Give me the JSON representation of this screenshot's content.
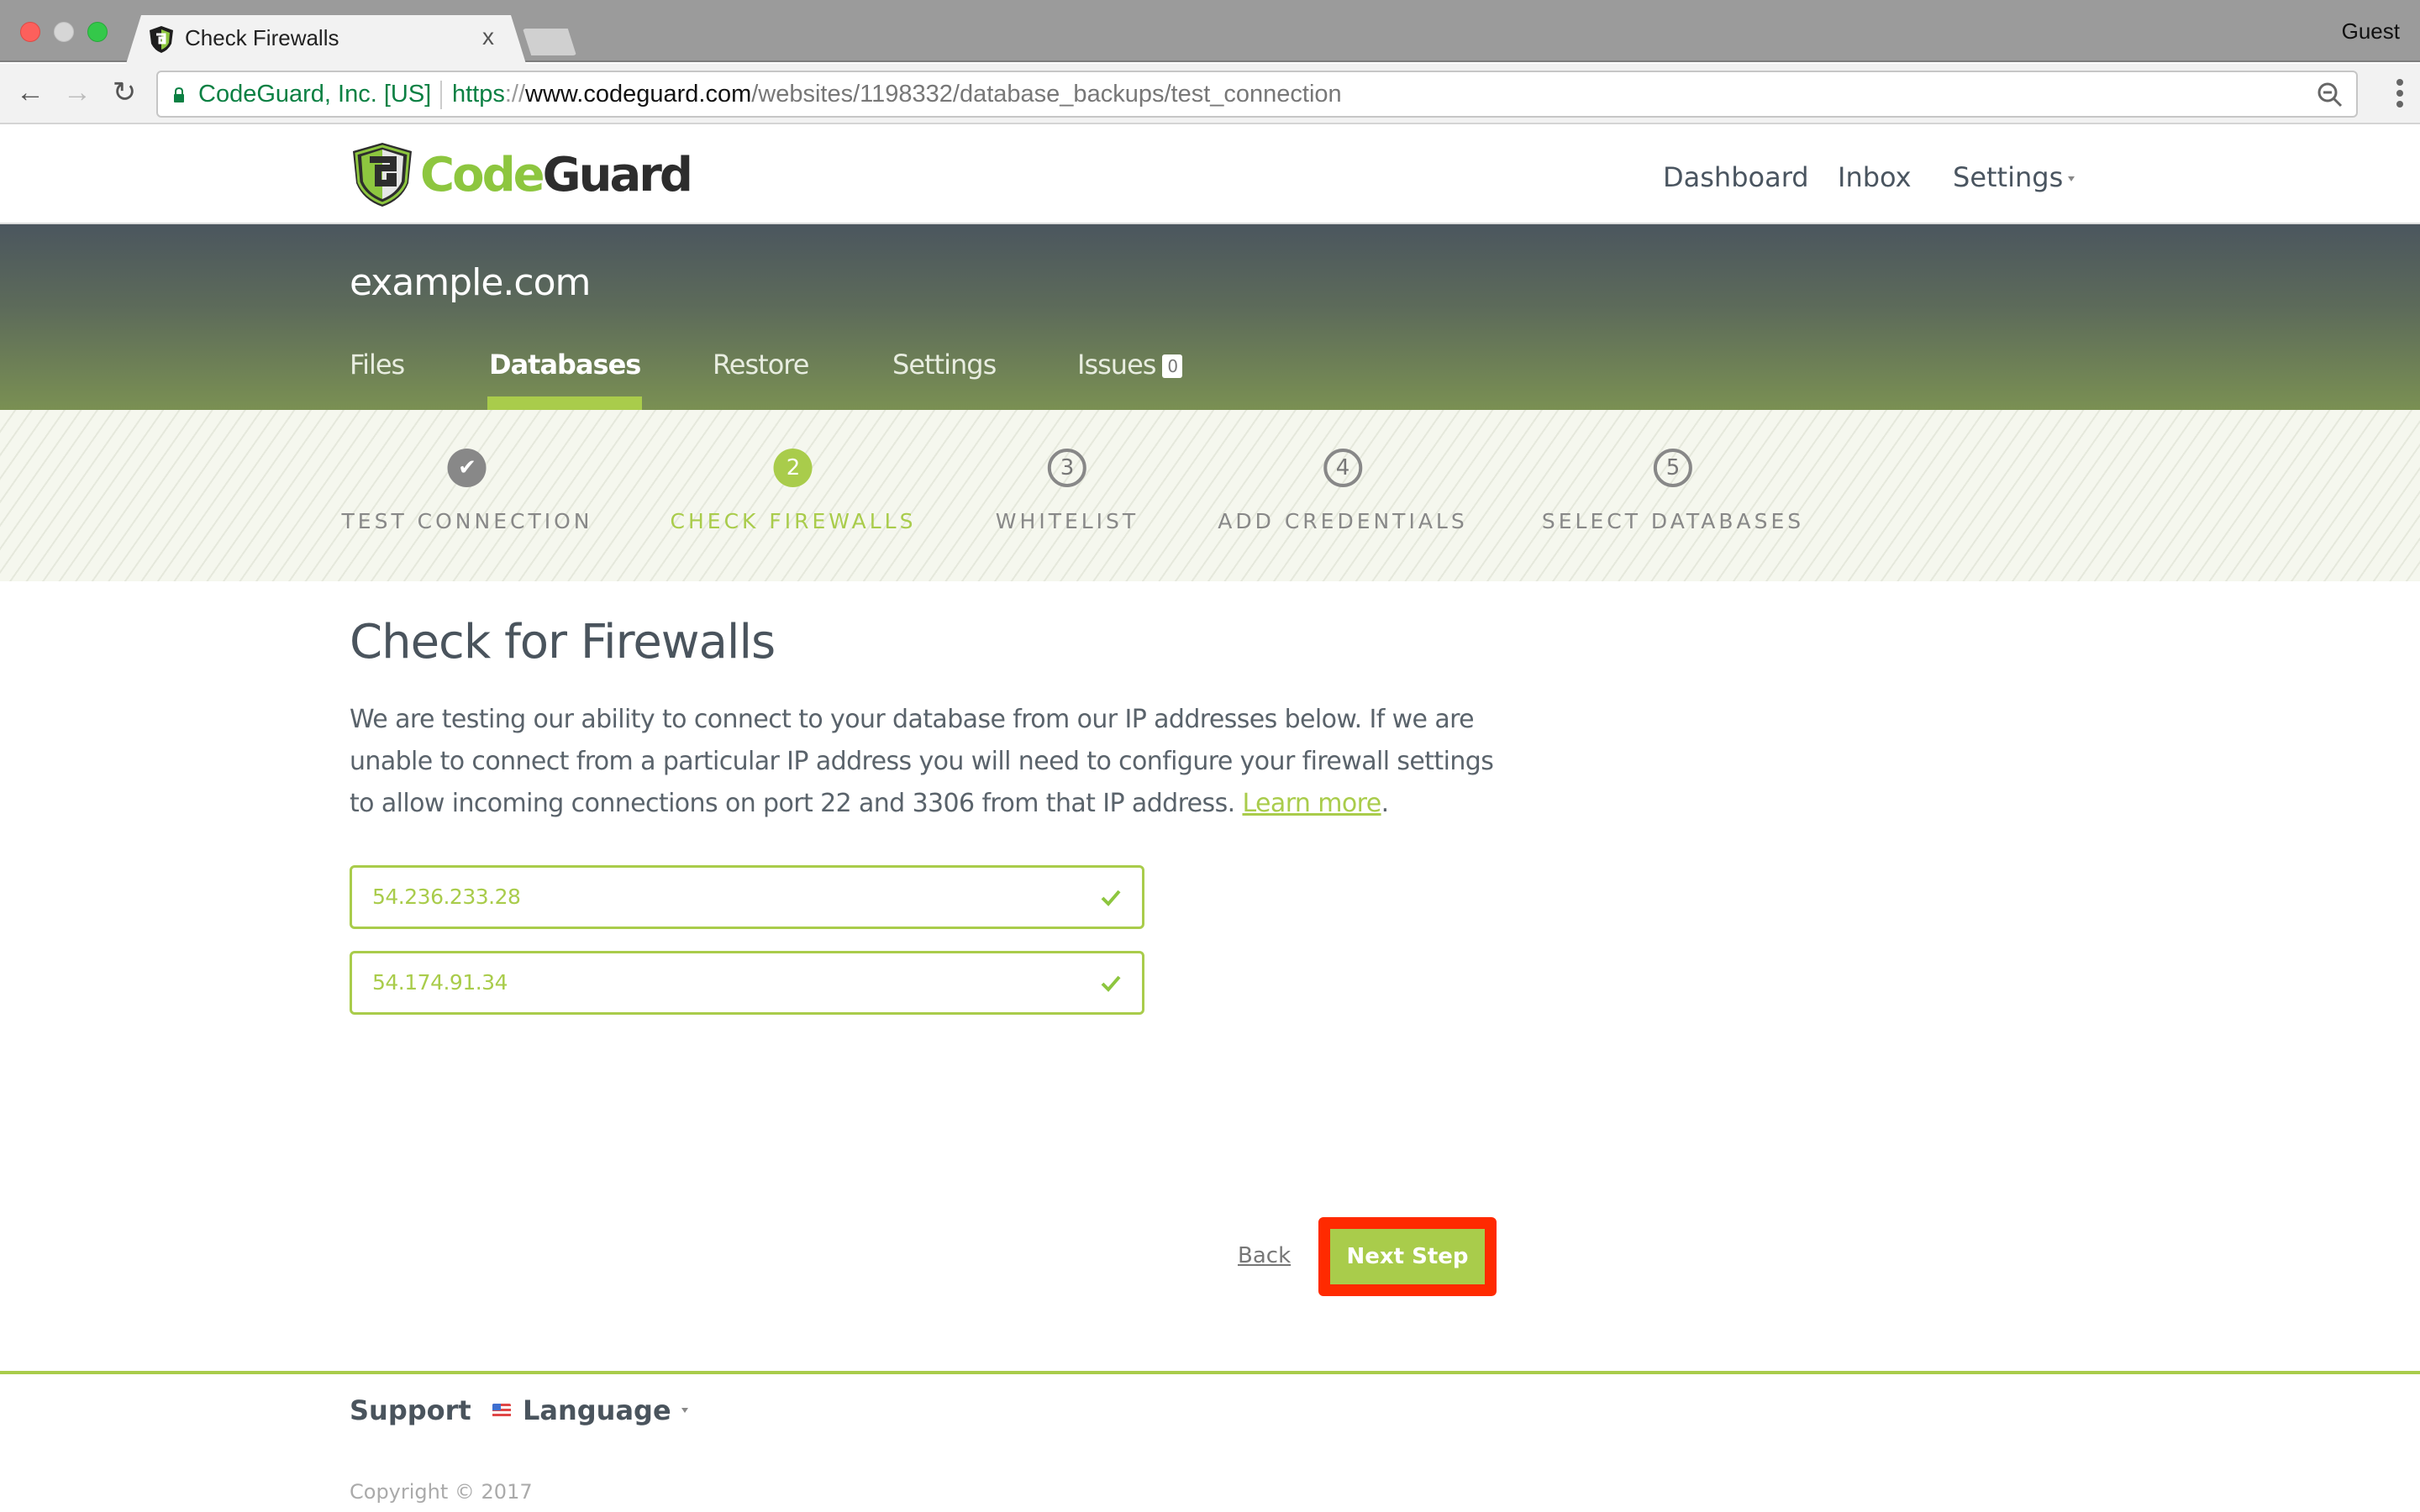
{
  "browser": {
    "tab_title": "Check Firewalls",
    "tab_close": "x",
    "profile": "Guest",
    "ev_label": "CodeGuard, Inc. [US]",
    "url": {
      "scheme": "https",
      "separator": "://",
      "host": "www.codeguard.com",
      "path": "/websites/1198332/database_backups/test_connection"
    },
    "icons": {
      "back": "arrow-left-icon",
      "forward": "arrow-right-icon",
      "reload": "reload-icon",
      "lock": "lock-icon",
      "zoom": "zoom-out-icon",
      "menu": "kebab-menu-icon"
    }
  },
  "header": {
    "logo": {
      "code": "Code",
      "guard": "Guard"
    },
    "nav": {
      "dashboard": "Dashboard",
      "inbox": "Inbox",
      "settings": "Settings"
    }
  },
  "site": {
    "name": "example.com",
    "tabs": [
      {
        "label": "Files",
        "active": false
      },
      {
        "label": "Databases",
        "active": true
      },
      {
        "label": "Restore",
        "active": false
      },
      {
        "label": "Settings",
        "active": false
      },
      {
        "label": "Issues",
        "active": false,
        "badge": "0"
      }
    ]
  },
  "stepper": {
    "steps": [
      {
        "number": "✔",
        "label": "TEST CONNECTION",
        "state": "done"
      },
      {
        "number": "2",
        "label": "CHECK FIREWALLS",
        "state": "current"
      },
      {
        "number": "3",
        "label": "WHITELIST",
        "state": "todo"
      },
      {
        "number": "4",
        "label": "ADD CREDENTIALS",
        "state": "todo"
      },
      {
        "number": "5",
        "label": "SELECT DATABASES",
        "state": "todo"
      }
    ]
  },
  "content": {
    "title": "Check for Firewalls",
    "description": "We are testing our ability to connect to your database from our IP addresses below. If we are unable to connect from a particular IP address you will need to configure your firewall settings to allow incoming connections on port 22 and 3306 from that IP address.",
    "learn_more": "Learn more",
    "trailing_period": ".",
    "ip_addresses": [
      {
        "ip": "54.236.233.28",
        "status": "success"
      },
      {
        "ip": "54.174.91.34",
        "status": "success"
      }
    ],
    "back_label": "Back",
    "next_label": "Next Step"
  },
  "footer": {
    "support": "Support",
    "language": "Language",
    "copyright": "Copyright © 2017"
  },
  "colors": {
    "accent_green": "#a9cc4b",
    "text_dark": "#4a545d",
    "highlight_red": "#ff2a00",
    "ev_green": "#0b8043"
  }
}
